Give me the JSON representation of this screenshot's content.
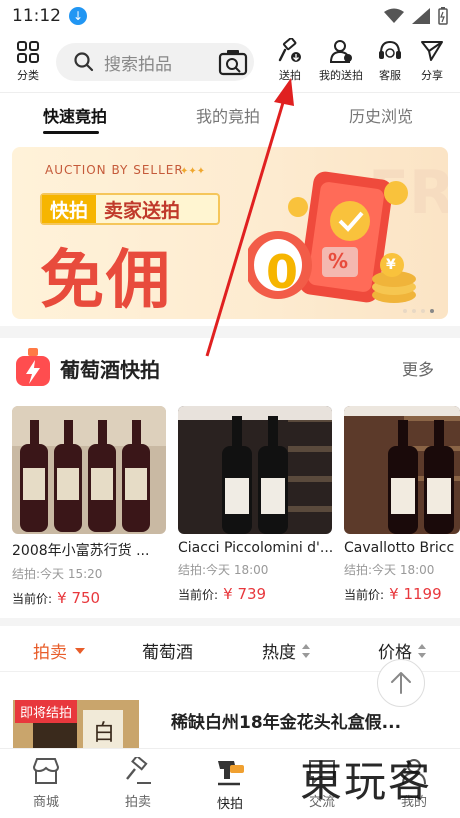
{
  "status_bar": {
    "time": "11:12"
  },
  "top_bar": {
    "category_label": "分类",
    "search_placeholder": "搜索拍品",
    "actions": [
      {
        "label": "送拍",
        "icon": "auction-hammer-icon"
      },
      {
        "label": "我的送拍",
        "icon": "user-icon"
      },
      {
        "label": "客服",
        "icon": "headset-icon"
      },
      {
        "label": "分享",
        "icon": "share-icon"
      }
    ]
  },
  "tabs": [
    "快速竟拍",
    "我的竟拍",
    "历史浏览"
  ],
  "banner": {
    "top_text": "AUCTION BY SELLER",
    "pill_a": "快拍",
    "pill_b": "卖家送拍",
    "big_text": "免佣",
    "badge_zero": "0",
    "badge_percent": "%",
    "coin": "¥"
  },
  "section": {
    "title": "葡萄酒快拍",
    "more": "更多"
  },
  "products": [
    {
      "name": "2008年小富苏行货 ...",
      "end": "结拍:今天 15:20",
      "price_label": "当前价:",
      "price": "¥ 750"
    },
    {
      "name": "Ciacci Piccolomini d'...",
      "end": "结拍:今天 18:00",
      "price_label": "当前价:",
      "price": "¥ 739"
    },
    {
      "name": "Cavallotto Bricc",
      "end": "结拍:今天 18:00",
      "price_label": "当前价:",
      "price": "¥ 1199"
    }
  ],
  "filters": [
    "拍卖",
    "葡萄酒",
    "热度",
    "价格"
  ],
  "list_item": {
    "badge": "即将结拍",
    "title": "稀缺白州18年金花头礼盒假..."
  },
  "bottom_nav": [
    {
      "label": "商城",
      "icon": "shop-icon"
    },
    {
      "label": "拍卖",
      "icon": "gavel-icon"
    },
    {
      "label": "快拍",
      "icon": "quick-auction-icon"
    },
    {
      "label": "交流",
      "icon": "chat-icon"
    },
    {
      "label": "我的",
      "icon": "profile-icon"
    }
  ],
  "watermark": "東玩客",
  "colors": {
    "accent": "#e85d2a",
    "price": "#e8383d",
    "banner_red": "#e84b3c",
    "arrow": "#e02020"
  }
}
